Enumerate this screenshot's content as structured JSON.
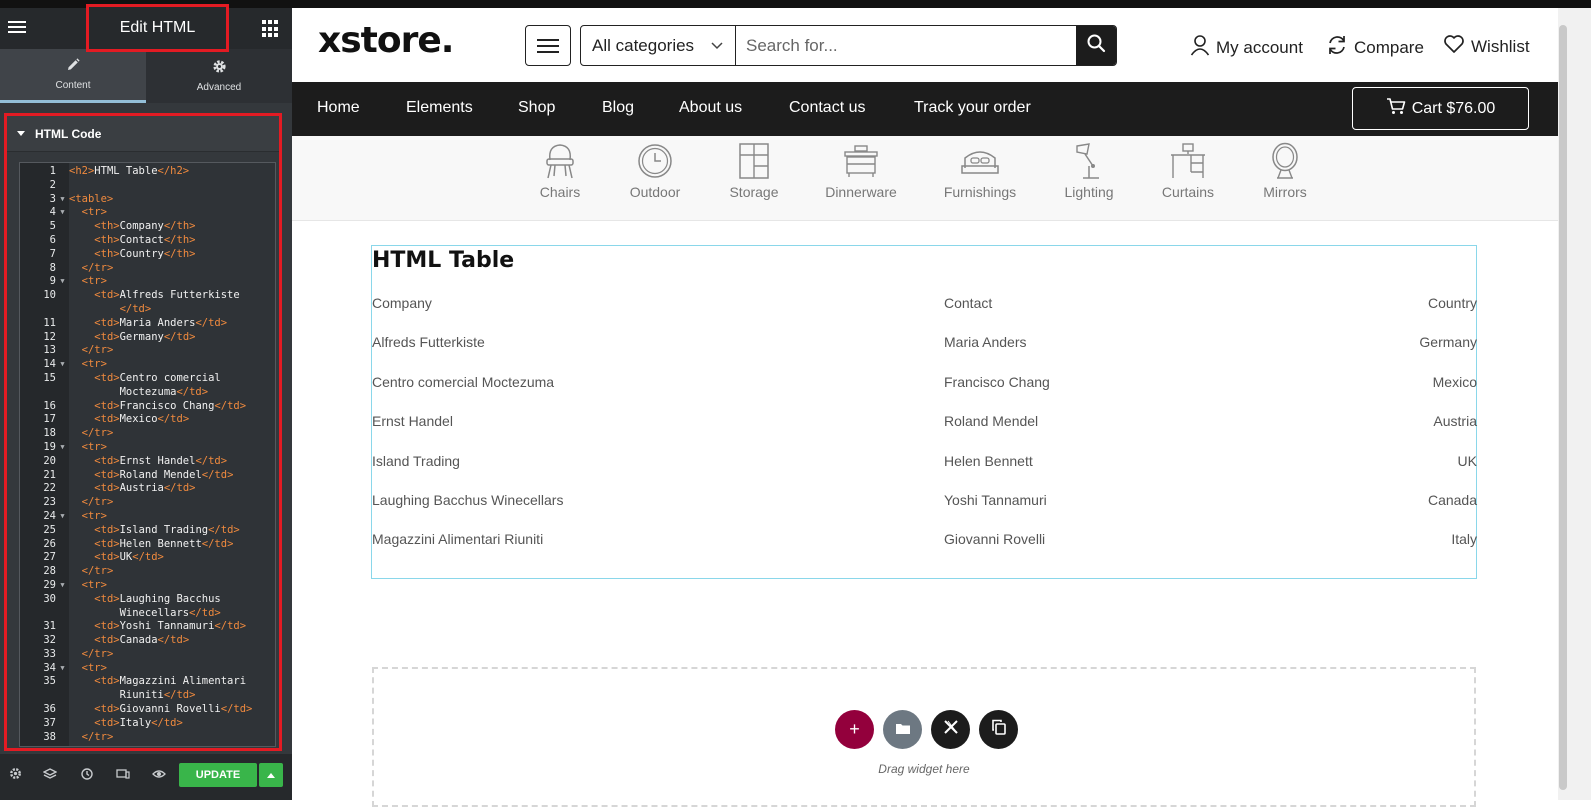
{
  "panel": {
    "title": "Edit HTML",
    "tabs": [
      {
        "label": "Content",
        "icon": "pencil-icon"
      },
      {
        "label": "Advanced",
        "icon": "gear-icon"
      }
    ],
    "section_title": "HTML Code",
    "code_lines": [
      {
        "n": "1",
        "fold": "",
        "html": "<span class=\"tg\">&lt;h2&gt;</span>HTML Table<span class=\"tg\">&lt;/h2&gt;</span>"
      },
      {
        "n": "2",
        "fold": "",
        "html": ""
      },
      {
        "n": "3",
        "fold": "▼",
        "html": "<span class=\"tg\">&lt;table&gt;</span>"
      },
      {
        "n": "4",
        "fold": "▼",
        "html": "  <span class=\"tg\">&lt;tr&gt;</span>"
      },
      {
        "n": "5",
        "fold": "",
        "html": "    <span class=\"tg\">&lt;th&gt;</span>Company<span class=\"tg\">&lt;/th&gt;</span>"
      },
      {
        "n": "6",
        "fold": "",
        "html": "    <span class=\"tg\">&lt;th&gt;</span>Contact<span class=\"tg\">&lt;/th&gt;</span>"
      },
      {
        "n": "7",
        "fold": "",
        "html": "    <span class=\"tg\">&lt;th&gt;</span>Country<span class=\"tg\">&lt;/th&gt;</span>"
      },
      {
        "n": "8",
        "fold": "",
        "html": "  <span class=\"tg\">&lt;/tr&gt;</span>"
      },
      {
        "n": "9",
        "fold": "▼",
        "html": "  <span class=\"tg\">&lt;tr&gt;</span>"
      },
      {
        "n": "10",
        "fold": "",
        "html": "    <span class=\"tg\">&lt;td&gt;</span>Alfreds Futterkiste"
      },
      {
        "n": "",
        "fold": "",
        "html": "        <span class=\"tg\">&lt;/td&gt;</span>"
      },
      {
        "n": "11",
        "fold": "",
        "html": "    <span class=\"tg\">&lt;td&gt;</span>Maria Anders<span class=\"tg\">&lt;/td&gt;</span>"
      },
      {
        "n": "12",
        "fold": "",
        "html": "    <span class=\"tg\">&lt;td&gt;</span>Germany<span class=\"tg\">&lt;/td&gt;</span>"
      },
      {
        "n": "13",
        "fold": "",
        "html": "  <span class=\"tg\">&lt;/tr&gt;</span>"
      },
      {
        "n": "14",
        "fold": "▼",
        "html": "  <span class=\"tg\">&lt;tr&gt;</span>"
      },
      {
        "n": "15",
        "fold": "",
        "html": "    <span class=\"tg\">&lt;td&gt;</span>Centro comercial"
      },
      {
        "n": "",
        "fold": "",
        "html": "        Moctezuma<span class=\"tg\">&lt;/td&gt;</span>"
      },
      {
        "n": "16",
        "fold": "",
        "html": "    <span class=\"tg\">&lt;td&gt;</span>Francisco Chang<span class=\"tg\">&lt;/td&gt;</span>"
      },
      {
        "n": "17",
        "fold": "",
        "html": "    <span class=\"tg\">&lt;td&gt;</span>Mexico<span class=\"tg\">&lt;/td&gt;</span>"
      },
      {
        "n": "18",
        "fold": "",
        "html": "  <span class=\"tg\">&lt;/tr&gt;</span>"
      },
      {
        "n": "19",
        "fold": "▼",
        "html": "  <span class=\"tg\">&lt;tr&gt;</span>"
      },
      {
        "n": "20",
        "fold": "",
        "html": "    <span class=\"tg\">&lt;td&gt;</span>Ernst Handel<span class=\"tg\">&lt;/td&gt;</span>"
      },
      {
        "n": "21",
        "fold": "",
        "html": "    <span class=\"tg\">&lt;td&gt;</span>Roland Mendel<span class=\"tg\">&lt;/td&gt;</span>"
      },
      {
        "n": "22",
        "fold": "",
        "html": "    <span class=\"tg\">&lt;td&gt;</span>Austria<span class=\"tg\">&lt;/td&gt;</span>"
      },
      {
        "n": "23",
        "fold": "",
        "html": "  <span class=\"tg\">&lt;/tr&gt;</span>"
      },
      {
        "n": "24",
        "fold": "▼",
        "html": "  <span class=\"tg\">&lt;tr&gt;</span>"
      },
      {
        "n": "25",
        "fold": "",
        "html": "    <span class=\"tg\">&lt;td&gt;</span>Island Trading<span class=\"tg\">&lt;/td&gt;</span>"
      },
      {
        "n": "26",
        "fold": "",
        "html": "    <span class=\"tg\">&lt;td&gt;</span>Helen Bennett<span class=\"tg\">&lt;/td&gt;</span>"
      },
      {
        "n": "27",
        "fold": "",
        "html": "    <span class=\"tg\">&lt;td&gt;</span>UK<span class=\"tg\">&lt;/td&gt;</span>"
      },
      {
        "n": "28",
        "fold": "",
        "html": "  <span class=\"tg\">&lt;/tr&gt;</span>"
      },
      {
        "n": "29",
        "fold": "▼",
        "html": "  <span class=\"tg\">&lt;tr&gt;</span>"
      },
      {
        "n": "30",
        "fold": "",
        "html": "    <span class=\"tg\">&lt;td&gt;</span>Laughing Bacchus"
      },
      {
        "n": "",
        "fold": "",
        "html": "        Winecellars<span class=\"tg\">&lt;/td&gt;</span>"
      },
      {
        "n": "31",
        "fold": "",
        "html": "    <span class=\"tg\">&lt;td&gt;</span>Yoshi Tannamuri<span class=\"tg\">&lt;/td&gt;</span>"
      },
      {
        "n": "32",
        "fold": "",
        "html": "    <span class=\"tg\">&lt;td&gt;</span>Canada<span class=\"tg\">&lt;/td&gt;</span>"
      },
      {
        "n": "33",
        "fold": "",
        "html": "  <span class=\"tg\">&lt;/tr&gt;</span>"
      },
      {
        "n": "34",
        "fold": "▼",
        "html": "  <span class=\"tg\">&lt;tr&gt;</span>"
      },
      {
        "n": "35",
        "fold": "",
        "html": "    <span class=\"tg\">&lt;td&gt;</span>Magazzini Alimentari"
      },
      {
        "n": "",
        "fold": "",
        "html": "        Riuniti<span class=\"tg\">&lt;/td&gt;</span>"
      },
      {
        "n": "36",
        "fold": "",
        "html": "    <span class=\"tg\">&lt;td&gt;</span>Giovanni Rovelli<span class=\"tg\">&lt;/td&gt;</span>"
      },
      {
        "n": "37",
        "fold": "",
        "html": "    <span class=\"tg\">&lt;td&gt;</span>Italy<span class=\"tg\">&lt;/td&gt;</span>"
      },
      {
        "n": "38",
        "fold": "",
        "html": "  <span class=\"tg\">&lt;/tr&gt;</span>"
      }
    ],
    "update_label": "UPDATE",
    "footer_icons": [
      "settings-icon",
      "layers-icon",
      "history-icon",
      "responsive-icon",
      "eye-icon"
    ]
  },
  "site": {
    "logo": "xstore.",
    "search": {
      "category": "All categories",
      "placeholder": "Search for..."
    },
    "header_links": {
      "account": "My account",
      "compare": "Compare",
      "wishlist": "Wishlist"
    },
    "nav": [
      "Home",
      "Elements",
      "Shop",
      "Blog",
      "About us",
      "Contact us",
      "Track your order"
    ],
    "cart_label": "Cart $76.00",
    "categories": [
      "Chairs",
      "Outdoor",
      "Storage",
      "Dinnerware",
      "Furnishings",
      "Lighting",
      "Curtains",
      "Mirrors"
    ],
    "table_widget": {
      "title": "HTML Table",
      "headers": [
        "Company",
        "Contact",
        "Country"
      ],
      "rows": [
        [
          "Alfreds Futterkiste",
          "Maria Anders",
          "Germany"
        ],
        [
          "Centro comercial Moctezuma",
          "Francisco Chang",
          "Mexico"
        ],
        [
          "Ernst Handel",
          "Roland Mendel",
          "Austria"
        ],
        [
          "Island Trading",
          "Helen Bennett",
          "UK"
        ],
        [
          "Laughing Bacchus Winecellars",
          "Yoshi Tannamuri",
          "Canada"
        ],
        [
          "Magazzini Alimentari Riuniti",
          "Giovanni Rovelli",
          "Italy"
        ]
      ]
    },
    "dropzone_text": "Drag widget here"
  },
  "colors": {
    "panel_bg": "#34383c",
    "highlight_red": "#e31b23",
    "update_green": "#39b54a",
    "nav_bg": "#1c1c1c",
    "widget_border": "#8ad7ea",
    "add_button": "#93003c"
  }
}
